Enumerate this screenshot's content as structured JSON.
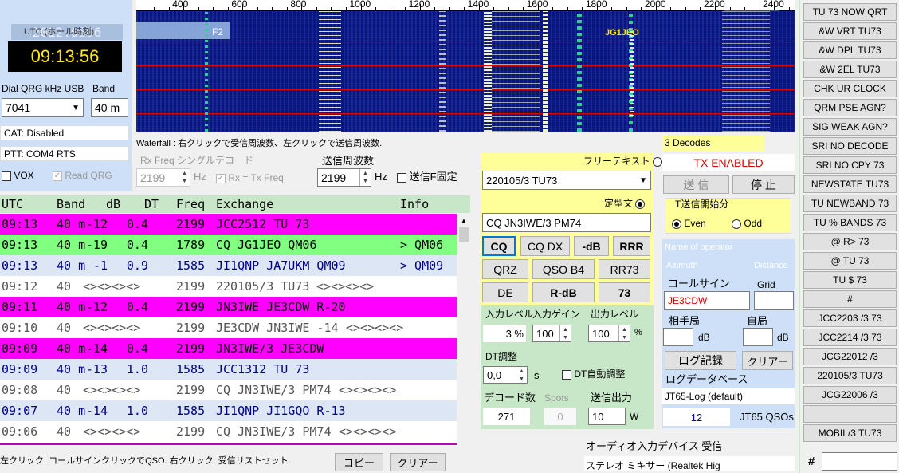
{
  "clock": {
    "title": "UTC (ホール時刻)",
    "time": "09:13:56",
    "ghost": "2012.0506"
  },
  "dial": {
    "label": "Dial QRG kHz USB",
    "value": "7041",
    "band_label": "Band",
    "band_value": "40 m"
  },
  "status": {
    "cat": "CAT: Disabled",
    "ptt": "PTT: COM4 RTS"
  },
  "checks": {
    "vox": "VOX",
    "read_qrg": "Read QRG",
    "rx_eq_tx": "Rx = Tx Freq",
    "tx_fixed": "送信F固定"
  },
  "waterfall": {
    "scale": [
      "400",
      "600",
      "800",
      "1000",
      "1200",
      "1400",
      "1600",
      "1800",
      "2000",
      "2200",
      "2400"
    ],
    "help": "Waterfall : 右クリックで受信周波数、左クリックで送信周波数.",
    "f2": "F2",
    "callsign": "JG1JEO"
  },
  "rxfreq": {
    "label": "Rx Freq シングルデコード",
    "value": "2199",
    "unit": "Hz"
  },
  "txfreq": {
    "label": "送信周波数",
    "value": "2199",
    "unit": "Hz"
  },
  "table": {
    "headers": [
      "UTC",
      "Band",
      "dB",
      "DT",
      "Freq",
      "Exchange",
      "Info"
    ],
    "rows": [
      {
        "utc": "09:13",
        "band": "40 m",
        "db": "-12",
        "dt": "0.4",
        "freq": "2199",
        "msg": "JCC2512 TU 73",
        "info": "",
        "bg": "#ff00ff",
        "color": "#000000"
      },
      {
        "utc": "09:13",
        "band": "40 m",
        "db": "-19",
        "dt": "0.4",
        "freq": "1789",
        "msg": "CQ JG1JEO QM06",
        "info": "> QM06",
        "bg": "#80ff80",
        "color": "#000000"
      },
      {
        "utc": "09:13",
        "band": "40 m",
        "db": "-1",
        "dt": "0.9",
        "freq": "1585",
        "msg": "JI1QNP JA7UKM QM09",
        "info": "> QM09",
        "bg": "#dce6f5",
        "color": "#00008b"
      },
      {
        "utc": "09:12",
        "band": "40",
        "db": "",
        "dt": "",
        "freq": "2199",
        "msg": "220105/3 TU73",
        "info": "",
        "bg": "#ffffff",
        "color": "#555555",
        "sep": "<><><><>"
      },
      {
        "utc": "09:11",
        "band": "40 m",
        "db": "-12",
        "dt": "0.4",
        "freq": "2199",
        "msg": "JN3IWE JE3CDW R-20",
        "info": "",
        "bg": "#ff00ff",
        "color": "#000000"
      },
      {
        "utc": "09:10",
        "band": "40",
        "db": "",
        "dt": "",
        "freq": "2199",
        "msg": "JE3CDW JN3IWE -14",
        "info": "",
        "bg": "#ffffff",
        "color": "#555555",
        "sep": "<><><><>"
      },
      {
        "utc": "09:09",
        "band": "40 m",
        "db": "-14",
        "dt": "0.4",
        "freq": "2199",
        "msg": "JN3IWE/3 JE3CDW",
        "info": "",
        "bg": "#ff00ff",
        "color": "#000000"
      },
      {
        "utc": "09:09",
        "band": "40 m",
        "db": "-13",
        "dt": "1.0",
        "freq": "1585",
        "msg": "JCC1312 TU 73",
        "info": "",
        "bg": "#dce6f5",
        "color": "#00008b"
      },
      {
        "utc": "09:08",
        "band": "40",
        "db": "",
        "dt": "",
        "freq": "2199",
        "msg": "CQ JN3IWE/3 PM74",
        "info": "",
        "bg": "#ffffff",
        "color": "#555555",
        "sep": "<><><><>"
      },
      {
        "utc": "09:07",
        "band": "40 m",
        "db": "-14",
        "dt": "1.0",
        "freq": "1585",
        "msg": "JI1QNP JI1GQO R-13",
        "info": "",
        "bg": "#dce6f5",
        "color": "#00008b"
      },
      {
        "utc": "09:06",
        "band": "40",
        "db": "",
        "dt": "",
        "freq": "2199",
        "msg": "CQ JN3IWE/3 PM74",
        "info": "",
        "bg": "#ffffff",
        "color": "#555555",
        "sep": "<><><><>"
      }
    ]
  },
  "footer": {
    "hint": "左クリック: コールサインクリックでQSO. 右クリック: 受信リストセット.",
    "copy": "コピー",
    "clear": "クリアー"
  },
  "tx": {
    "free_label": "フリーテキスト",
    "free_value": "220105/3 TU73",
    "fixed_label": "定型文",
    "fixed_value": "CQ JN3IWE/3 PM74",
    "buttons": [
      [
        "CQ",
        "CQ DX",
        "-dB",
        "RRR"
      ],
      [
        "QRZ",
        "QSO B4",
        "RR73"
      ],
      [
        "DE",
        "R-dB",
        "73"
      ]
    ]
  },
  "levels": {
    "in_label": "入力レベル",
    "in_value": "3 %",
    "gain_label": "入力ゲイン",
    "gain_value": "100",
    "out_label": "出力レベル",
    "out_value": "100",
    "out_unit": "%"
  },
  "dt": {
    "label": "DT調整",
    "value": "0,0",
    "unit": "s",
    "auto": "DT自動調整"
  },
  "decode": {
    "count_label": "デコード数",
    "count_value": "271",
    "spots_label": "Spots",
    "spots_value": "0",
    "power_label": "送信出力",
    "power_value": "10",
    "power_unit": "W"
  },
  "decodes_status": "3 Decodes",
  "tx_status": "TX ENABLED",
  "tx_buttons": {
    "send": "送 信",
    "stop": "停 止"
  },
  "tx_start": {
    "label": "T送信開始分",
    "even": "Even",
    "odd": "Odd"
  },
  "qso": {
    "op_name": "Name of operator",
    "azimuth": "Azimuth",
    "distance": "Distance",
    "call_label": "コールサイン",
    "call_value": "JE3CDW",
    "grid_label": "Grid",
    "dx_label": "相手局",
    "my_label": "自局",
    "db": "dB",
    "log": "ログ記録",
    "clear": "クリアー",
    "db_label": "ログデータベース",
    "db_value": "JT65-Log (default)",
    "count": "12",
    "count_label": "JT65 QSOs"
  },
  "audio": {
    "label": "オーディオ入力デバイス  受信",
    "device": "ステレオ ミキサー (Realtek Hig"
  },
  "macros": [
    "TU 73 NOW QRT",
    "&W VRT TU73",
    "&W DPL TU73",
    "&W 2EL TU73",
    "CHK UR CLOCK",
    "QRM PSE AGN?",
    "SIG WEAK AGN?",
    "SRI NO DECODE",
    "SRI NO CPY 73",
    "NEWSTATE TU73",
    "TU NEWBAND 73",
    "TU % BANDS 73",
    "@ R> 73",
    "@ TU 73",
    "TU $ 73",
    "#",
    "JCC2203 /3 73",
    "JCC2214 /3 73",
    "JCG22012 /3",
    "220105/3 TU73",
    "JCG22006 /3",
    "",
    "MOBIL/3 TU73"
  ],
  "macro_input_label": "#",
  "colors": {
    "panel_blue": "#cde0f7",
    "yellow": "#ffff99",
    "tx_red": "#e00000",
    "highlight": "#ff00ff",
    "cq_green": "#80ff80"
  }
}
